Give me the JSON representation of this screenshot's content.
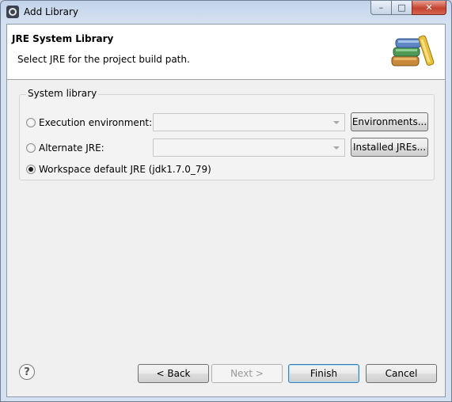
{
  "window": {
    "title": "Add Library",
    "controls": {
      "minimize": "–",
      "maximize": "□",
      "close": "✕"
    }
  },
  "header": {
    "title": "JRE System Library",
    "message": "Select JRE for the project build path."
  },
  "system_library": {
    "label": "System library",
    "options": [
      {
        "label": "Execution environment:",
        "checked": false,
        "combo_value": "",
        "button": "Environments..."
      },
      {
        "label": "Alternate JRE:",
        "checked": false,
        "combo_value": "",
        "button": "Installed JREs..."
      },
      {
        "label": "Workspace default JRE (jdk1.7.0_79)",
        "checked": true
      }
    ]
  },
  "footer": {
    "help": "?",
    "back": "< Back",
    "next": "Next >",
    "finish": "Finish",
    "cancel": "Cancel"
  },
  "colors": {
    "title_bar": "#c2d3ea",
    "close_button": "#c4432f",
    "default_button_border": "#3c7fb1"
  },
  "icons": {
    "app": "eclipse-icon",
    "banner": "books-library-icon",
    "help": "help-icon"
  }
}
